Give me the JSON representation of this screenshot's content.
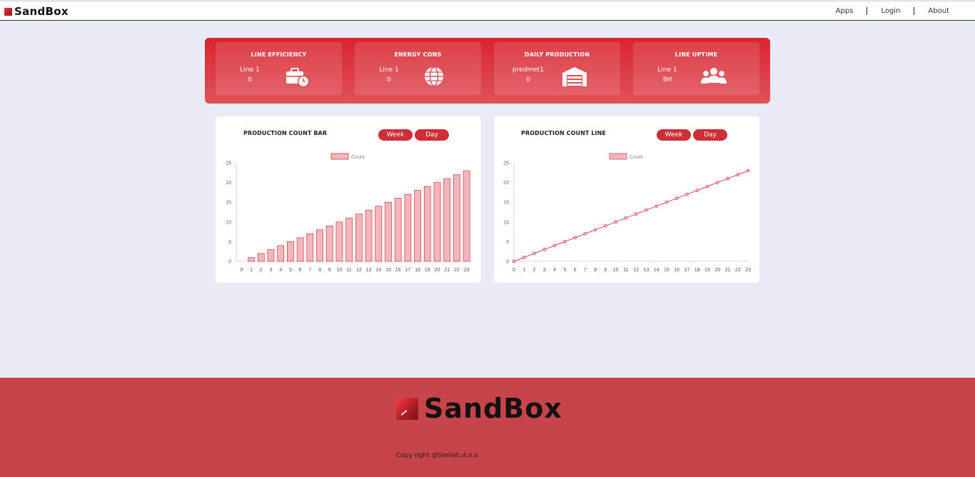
{
  "header": {
    "brand": "SandBox",
    "nav": [
      "Apps",
      "Login",
      "About"
    ]
  },
  "kpis": [
    {
      "title": "LINE EFFICIENCY",
      "label": "Line 1",
      "value": "0",
      "icon": "briefcase-clock-icon"
    },
    {
      "title": "ENERGY CONS",
      "label": "Line 1",
      "value": "0",
      "icon": "globe-icon"
    },
    {
      "title": "DAILY PRODUCTION",
      "label": "predmet1",
      "value": "0",
      "icon": "warehouse-icon"
    },
    {
      "title": "LINE UPTIME",
      "label": "Line 1",
      "value": "8H",
      "icon": "users-icon"
    }
  ],
  "charts": [
    {
      "title": "PRODUCTION COUNT BAR",
      "toggles": [
        "Week",
        "Day"
      ]
    },
    {
      "title": "PRODUCTION COUNT LINE",
      "toggles": [
        "Week",
        "Day"
      ]
    }
  ],
  "chart_data": [
    {
      "type": "bar",
      "legend": "Count",
      "categories": [
        "0",
        "1",
        "2",
        "3",
        "4",
        "5",
        "6",
        "7",
        "8",
        "9",
        "10",
        "11",
        "12",
        "13",
        "14",
        "15",
        "16",
        "17",
        "18",
        "19",
        "20",
        "21",
        "22",
        "23"
      ],
      "series": [
        {
          "name": "Count",
          "values": [
            0,
            1,
            2,
            3,
            4,
            5,
            6,
            7,
            8,
            9,
            10,
            11,
            12,
            13,
            14,
            15,
            16,
            17,
            18,
            19,
            20,
            21,
            22,
            23
          ]
        }
      ],
      "ylim": [
        0,
        25
      ],
      "yticks": [
        0,
        5,
        10,
        15,
        20,
        25
      ],
      "color": "#f4b6ba",
      "stroke": "#c93a44"
    },
    {
      "type": "line",
      "legend": "Count",
      "categories": [
        "0",
        "1",
        "2",
        "3",
        "4",
        "5",
        "6",
        "7",
        "8",
        "9",
        "10",
        "11",
        "12",
        "13",
        "14",
        "15",
        "16",
        "17",
        "18",
        "19",
        "20",
        "21",
        "22",
        "23"
      ],
      "series": [
        {
          "name": "Count",
          "values": [
            0,
            1,
            2,
            3,
            4,
            5,
            6,
            7,
            8,
            9,
            10,
            11,
            12,
            13,
            14,
            15,
            16,
            17,
            18,
            19,
            20,
            21,
            22,
            23
          ]
        }
      ],
      "ylim": [
        0,
        25
      ],
      "yticks": [
        0,
        5,
        10,
        15,
        20,
        25
      ],
      "color": "#f4b6ba",
      "stroke": "#d9525b"
    }
  ],
  "footer": {
    "brand": "SandBox",
    "copyright": "Copy right @Senlab.d.o.o"
  }
}
